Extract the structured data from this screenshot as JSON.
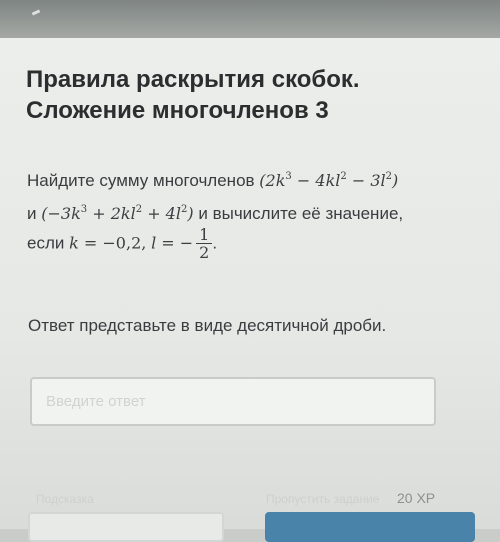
{
  "lesson": {
    "title_line1": "Правила раскрытия скобок.",
    "title_line2": "Сложение многочленов 3"
  },
  "task": {
    "line1_text": "Найдите сумму многочленов",
    "line1_math": "(2k³ − 4kl² − 3l²)",
    "line2_prefix": "и",
    "line2_math": "(−3k³ + 2kl² + 4l²)",
    "line2_text": "и вычислите её значение,",
    "line3_text": "если",
    "k_value": "k = −0,2,",
    "l_value": "l = −",
    "l_numerator": "1",
    "l_denominator": "2",
    "end_punct": "."
  },
  "note": "Ответ представьте в виде десятичной дроби.",
  "answer": {
    "value": "",
    "placeholder": "Введите ответ"
  },
  "footer": {
    "hint_label": "Подсказка",
    "skip_label": "Пропустить задание",
    "xp": "20 XP"
  },
  "colors": {
    "primary_button": "#4a83a9",
    "title": "#2b2d2f"
  }
}
